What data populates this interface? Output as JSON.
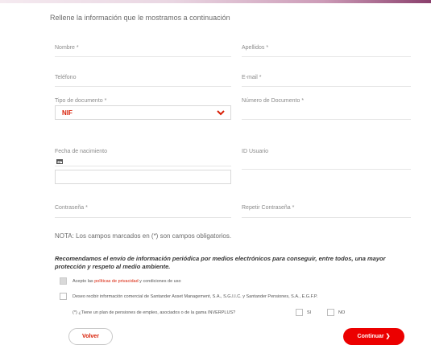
{
  "intro": "Rellene la información que le mostramos a continuación",
  "fields": {
    "nombre": "Nombre *",
    "apellidos": "Apellidos *",
    "telefono": "Teléfono",
    "email": "E-mail *",
    "tipo_documento": "Tipo de documento *",
    "tipo_documento_value": "NIF",
    "numero_documento": "Número de Documento *",
    "fecha_nacimiento": "Fecha de nacimiento",
    "id_usuario": "ID Usuario",
    "contrasena": "Contraseña *",
    "repetir_contrasena": "Repetir Contraseña *"
  },
  "nota": "NOTA: Los campos marcados en (*) son campos obligatorios.",
  "recomendacion": "Recomendamos el envío de información periódica por medios electrónicos para conseguir, entre todos, una mayor protección y respeto al medio ambiente.",
  "consent": {
    "acepto_prefix": "Acepto las ",
    "acepto_link": "políticas de privacidad",
    "acepto_suffix": " y condiciones de uso",
    "comercial": "Deseo recibir información comercial de Santander Asset Management, S.A., S.G.I.I.C. y Santander Pensiones, S.A., E.G.F.P.",
    "plan_question": "(*) ¿Tiene un plan de pensiones de empleo, asociados o de la gama INVERPLUS?",
    "si": "SI",
    "no": "NO"
  },
  "buttons": {
    "volver": "Volver",
    "continuar": "Continuar"
  },
  "icons": {
    "calendar": "calendar-icon",
    "chevron": "chevron-down-icon",
    "arrow": "chevron-right-icon"
  },
  "colors": {
    "accent": "#ec0000",
    "link": "#d81e05"
  }
}
